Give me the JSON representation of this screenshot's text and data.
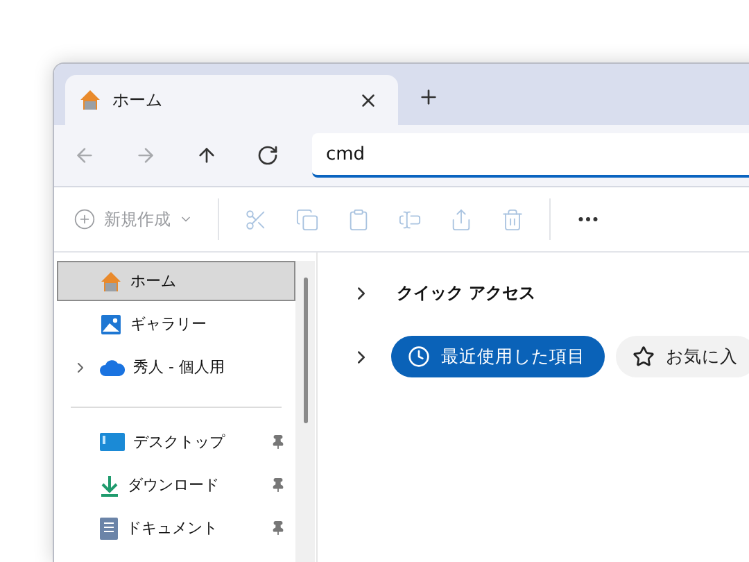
{
  "tabs": [
    {
      "label": "ホーム",
      "selected": true
    }
  ],
  "nav": [
    {
      "kind": "back",
      "disabled": true
    },
    {
      "kind": "forward",
      "disabled": true
    },
    {
      "kind": "up",
      "disabled": false
    },
    {
      "kind": "refresh",
      "disabled": false
    }
  ],
  "address": {
    "value": "cmd"
  },
  "toolbar": {
    "new_label": "新規作成",
    "new_disabled": true,
    "actions": [
      {
        "kind": "cut",
        "disabled": true
      },
      {
        "kind": "copy",
        "disabled": true
      },
      {
        "kind": "paste",
        "disabled": true
      },
      {
        "kind": "rename",
        "disabled": true
      },
      {
        "kind": "share",
        "disabled": true
      },
      {
        "kind": "delete",
        "disabled": true
      }
    ]
  },
  "sidebar": {
    "groups": [
      [
        {
          "kind": "home",
          "label": "ホーム",
          "selected": true
        },
        {
          "kind": "gallery",
          "label": "ギャラリー",
          "selected": false
        },
        {
          "kind": "cloud",
          "label": "秀人 - 個人用",
          "selected": false,
          "expanded": false
        }
      ],
      [
        {
          "kind": "desktop",
          "label": "デスクトップ",
          "selected": false,
          "pinned": true
        },
        {
          "kind": "download",
          "label": "ダウンロード",
          "selected": false,
          "pinned": true
        },
        {
          "kind": "document",
          "label": "ドキュメント",
          "selected": false,
          "pinned": true
        }
      ]
    ]
  },
  "main": {
    "sections": [
      {
        "kind": "heading",
        "label": "クイック アクセス",
        "expanded": false
      },
      {
        "kind": "filters",
        "expanded": false,
        "filters": [
          {
            "kind": "recent",
            "label": "最近使用した項目",
            "selected": true
          },
          {
            "kind": "favorites",
            "label": "お気に入",
            "selected": false
          }
        ]
      }
    ]
  }
}
